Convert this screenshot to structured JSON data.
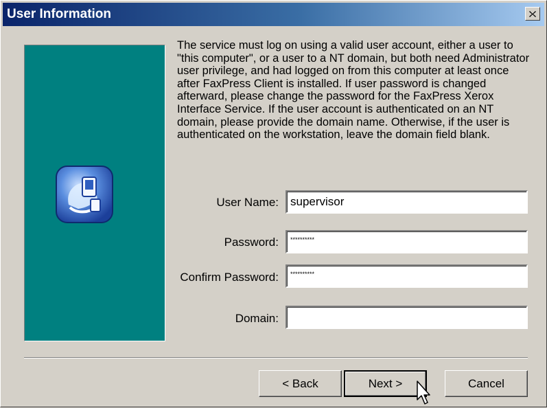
{
  "window": {
    "title": "User Information",
    "close_icon": "close-icon",
    "colors": {
      "title_start": "#0a246a",
      "title_end": "#a6caf0",
      "panel": "#008080",
      "face": "#d4d0c8"
    }
  },
  "description": "The service must log on using a valid user account, either a user to \"this computer\", or a user to a NT domain, but both need Administrator user privilege, and had logged on from this computer at least once after FaxPress Client is installed. If user password is changed afterward, please change the password for the FaxPress Xerox Interface Service. If the user account is authenticated on an NT domain, please provide the domain name. Otherwise, if the user is authenticated on the workstation, leave the domain field blank.",
  "form": {
    "user_name_label": "User Name:",
    "user_name_value": "supervisor",
    "password_label": "Password:",
    "password_value": "**********",
    "confirm_password_label": "Confirm Password:",
    "confirm_password_value": "**********",
    "domain_label": "Domain:",
    "domain_value": ""
  },
  "buttons": {
    "back": "< Back",
    "next": "Next >",
    "cancel": "Cancel"
  },
  "icons": {
    "logo": "computer-setup-icon",
    "cursor": "mouse-pointer-icon"
  }
}
